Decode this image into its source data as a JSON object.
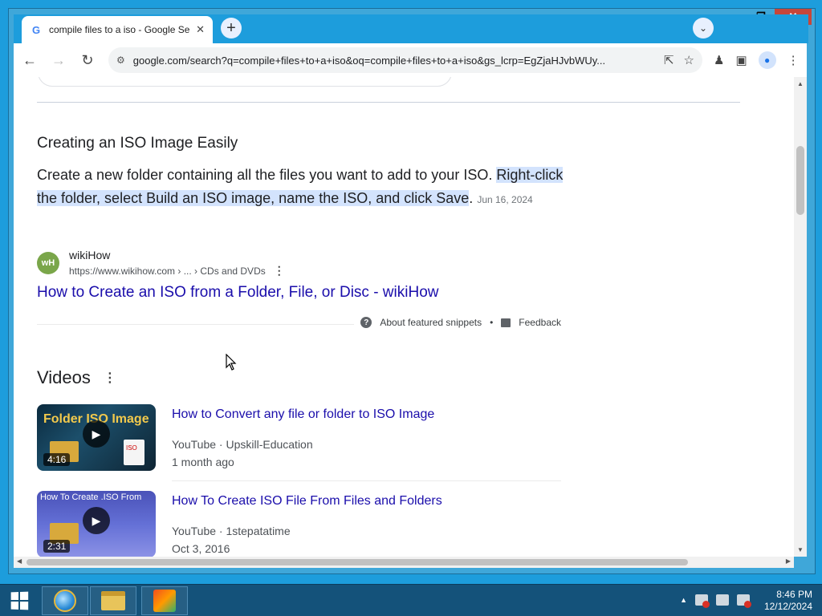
{
  "browser": {
    "tab_title": "compile files to a iso - Google Se",
    "tab_favicon": "G",
    "url": "google.com/search?q=compile+files+to+a+iso&oq=compile+files+to+a+iso&gs_lcrp=EgZjaHJvbWUy..."
  },
  "snippet": {
    "heading": "Creating an ISO Image Easily",
    "text_plain": "Create a new folder containing all the files you want to add to your ISO. ",
    "text_highlight": "Right-click the folder, select Build an ISO image, name the ISO, and click Save",
    "text_end": ".",
    "date": "Jun 16, 2024",
    "source_logo": "wH",
    "source_name": "wikiHow",
    "source_url": "https://www.wikihow.com › ... › CDs and DVDs",
    "link": "How to Create an ISO from a Folder, File, or Disc - wikiHow",
    "about": "About featured snippets",
    "bullet": "•",
    "feedback": "Feedback"
  },
  "videos": {
    "heading": "Videos",
    "items": [
      {
        "title": "How to Convert any file or folder to ISO Image",
        "platform": "YouTube",
        "channel": "Upskill-Education",
        "date": "1 month ago",
        "duration": "4:16",
        "thumb_text": "Folder   ISO Image",
        "thumb_badge": "ISO"
      },
      {
        "title": "How To Create ISO File From Files and Folders",
        "platform": "YouTube",
        "channel": "1stepatatime",
        "date": "Oct 3, 2016",
        "duration": "2:31",
        "thumb_text": "How To Create .ISO From"
      }
    ]
  },
  "taskbar": {
    "time": "8:46 PM",
    "date": "12/12/2024"
  },
  "colors": {
    "link": "#1a0dab",
    "highlight": "#d3e3fd",
    "desktop": "#1d9ddc",
    "close_button": "#c7463a"
  }
}
